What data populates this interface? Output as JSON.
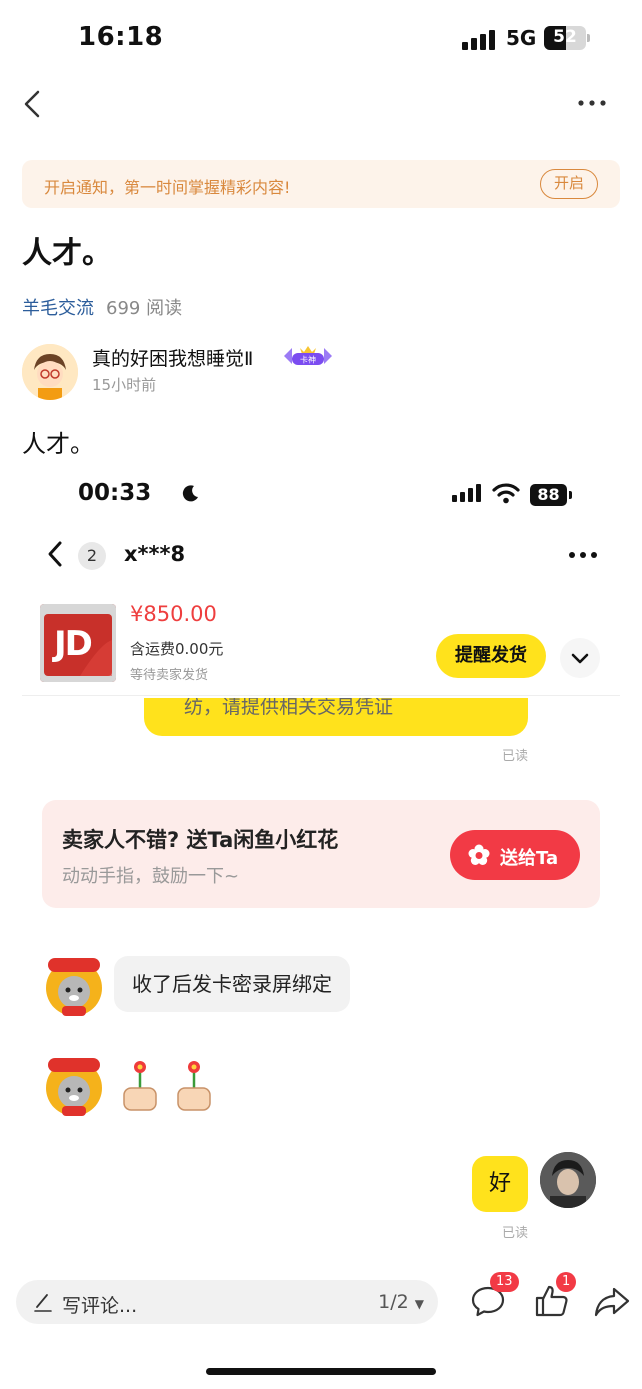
{
  "status_bar": {
    "time": "16:18",
    "network": "5G",
    "battery": "52",
    "battery_level": 0.52
  },
  "notify": {
    "text": "开启通知，第一时间掌握精彩内容!",
    "button": "开启"
  },
  "post": {
    "title": "人才。",
    "circle": "羊毛交流",
    "read_count": "699 阅读",
    "author": "真的好困我想睡觉Ⅱ",
    "badge": "卡神",
    "time": "15小时前",
    "body": "人才。"
  },
  "screenshot": {
    "status_time": "00:33",
    "battery": "88",
    "unread": "2",
    "chat_user": "x***8",
    "product": {
      "price": "¥850.00",
      "shipping": "含运费0.00元",
      "status": "等待卖家发货",
      "remind_button": "提醒发货",
      "image_label": "JD"
    },
    "cut_message": "纺，请提供相关交易凭证",
    "read_label_1": "已读",
    "flower_card": {
      "title": "卖家人不错? 送Ta闲鱼小红花",
      "subtitle": "动动手指，鼓励一下~",
      "button": "送给Ta"
    },
    "seller_message": "收了后发卡密录屏绑定",
    "my_message": "好",
    "read_label_2": "已读"
  },
  "bottom_bar": {
    "comment_placeholder": "写评论...",
    "page_indicator": "1/2",
    "comment_count": "13",
    "like_count": "1"
  },
  "colors": {
    "accent_yellow": "#ffe21c",
    "red": "#f23a45",
    "link_blue": "#2c5d9b",
    "notify_orange": "#d9893e"
  }
}
